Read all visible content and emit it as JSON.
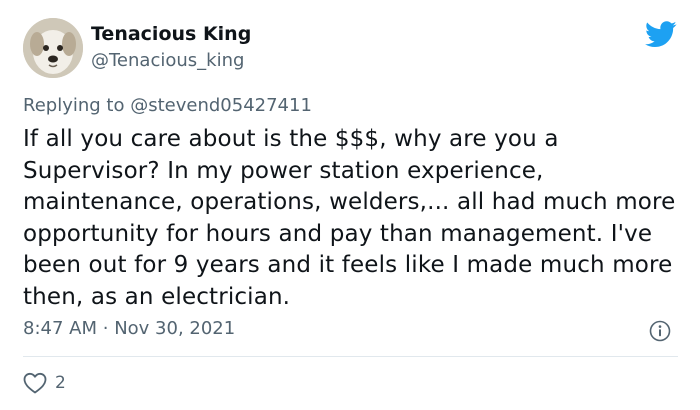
{
  "author": {
    "display_name": "Tenacious King",
    "handle": "@Tenacious_king"
  },
  "reply": {
    "prefix": "Replying to",
    "mention": "@stevend05427411"
  },
  "body": "If all you care about is the $$$, why are you a Supervisor? In my power station experience, maintenance, operations, welders,... all had much more opportunity for hours and pay than management. I've been out for 9 years and it feels like I made much more then, as an electrician.",
  "meta": {
    "time": "8:47 AM",
    "separator": "·",
    "date": "Nov 30, 2021"
  },
  "actions": {
    "like_count": "2"
  },
  "icons": {
    "brand": "twitter-bird-icon",
    "info": "info-icon",
    "like": "heart-icon"
  },
  "colors": {
    "brand": "#1da1f2",
    "text": "#0f1419",
    "secondary": "#536471",
    "divider": "#e1e8ed"
  }
}
